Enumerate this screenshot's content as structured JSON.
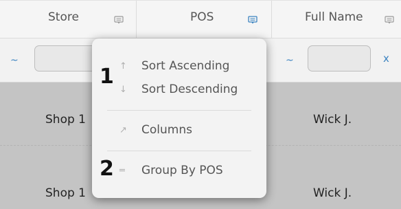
{
  "header": {
    "columns": [
      {
        "label": "Store",
        "icon": "column-menu-icon"
      },
      {
        "label": "POS",
        "icon": "column-menu-icon",
        "active": true
      },
      {
        "label": "Full Name",
        "icon": "column-menu-icon"
      }
    ]
  },
  "filters": {
    "operator_symbol": "~",
    "clear_label": "x"
  },
  "rows": [
    {
      "store": "Shop 1",
      "full_name": "Wick J."
    },
    {
      "store": "Shop 1",
      "full_name": "Wick J."
    }
  ],
  "column_menu": {
    "items": [
      {
        "icon": "arrow-up-icon",
        "glyph": "↑",
        "label": "Sort Ascending"
      },
      {
        "icon": "arrow-down-icon",
        "glyph": "↓",
        "label": "Sort Descending"
      },
      {
        "icon": "external-link-icon",
        "glyph": "↗",
        "label": "Columns"
      },
      {
        "icon": "group-icon",
        "glyph": "═",
        "label": "Group By POS"
      }
    ]
  },
  "annotations": {
    "step1": "1",
    "step2": "2"
  },
  "colors": {
    "accent": "#3b83c0",
    "row_background": "#c4c4c4",
    "header_background": "#f5f5f5"
  }
}
